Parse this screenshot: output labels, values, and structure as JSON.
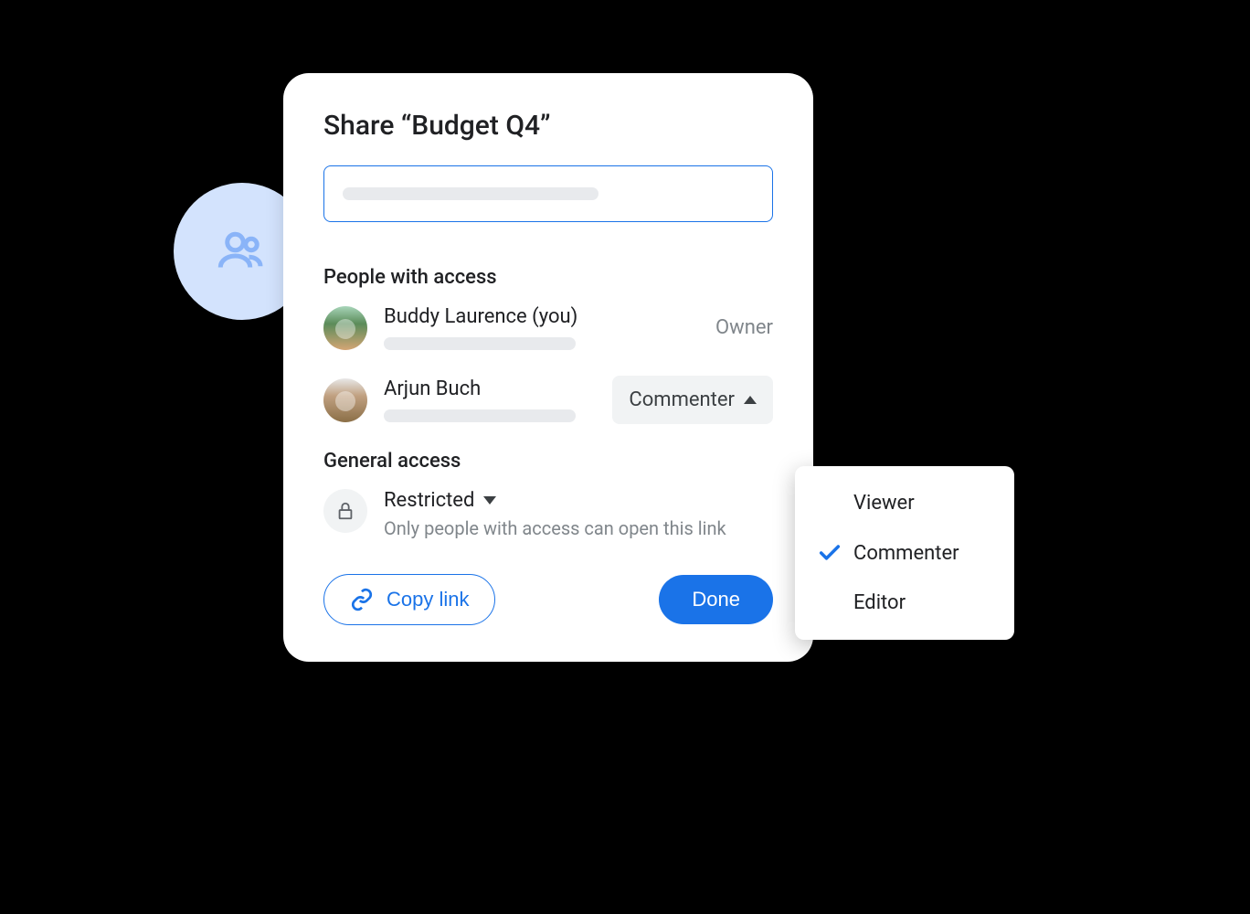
{
  "dialog": {
    "title": "Share “Budget Q4”",
    "people_heading": "People with access",
    "people": [
      {
        "name": "Buddy Laurence (you)",
        "role": "Owner"
      },
      {
        "name": "Arjun Buch",
        "role": "Commenter"
      }
    ],
    "general_heading": "General access",
    "restricted": {
      "label": "Restricted",
      "description": "Only people with access can open this link"
    },
    "buttons": {
      "copy_link": "Copy link",
      "done": "Done"
    }
  },
  "dropdown": {
    "options": [
      "Viewer",
      "Commenter",
      "Editor"
    ],
    "selected": "Commenter"
  }
}
